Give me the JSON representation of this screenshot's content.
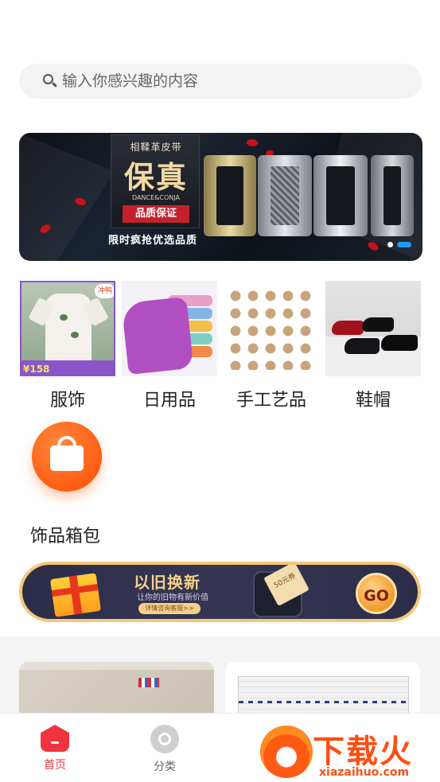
{
  "search": {
    "placeholder": "输入你感兴趣的内容"
  },
  "banner": {
    "subtitle": "相鞣革皮带",
    "title": "保真",
    "brand": "DANCE&CONJA",
    "badge": "品质保证",
    "tagline": "限时疯抢优选品质",
    "slides_total": 2,
    "active_slide": 2
  },
  "categories": [
    {
      "label": "服饰",
      "price_tag": "158",
      "chip": "冲鸭"
    },
    {
      "label": "日用品"
    },
    {
      "label": "手工艺品"
    },
    {
      "label": "鞋帽"
    },
    {
      "label": "饰品箱包",
      "icon": "shopping-bag-icon"
    }
  ],
  "promo": {
    "title": "以旧换新",
    "subtitle": "让你的旧物有新价值",
    "link": "详情咨询客服>>",
    "coupon": "50元券",
    "go": "GO"
  },
  "tabbar": {
    "items": [
      {
        "label": "首页",
        "icon": "home-icon",
        "active": true
      },
      {
        "label": "分类",
        "icon": "category-icon",
        "active": false
      }
    ]
  },
  "watermark": {
    "title": "下载火",
    "url": "xiazaihuo.com"
  },
  "colors": {
    "accent": "#f0343f",
    "orange": "#ff6a1e",
    "dot_active": "#1e9bff"
  }
}
